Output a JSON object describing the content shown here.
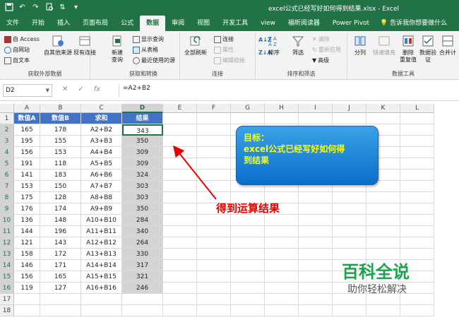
{
  "window": {
    "title": "excel公式已经写好如何得到结果.xlsx  -  Excel"
  },
  "tabs": [
    {
      "label": "文件",
      "active": false
    },
    {
      "label": "开始",
      "active": false
    },
    {
      "label": "插入",
      "active": false
    },
    {
      "label": "页面布局",
      "active": false
    },
    {
      "label": "公式",
      "active": false
    },
    {
      "label": "数据",
      "active": true
    },
    {
      "label": "审阅",
      "active": false
    },
    {
      "label": "视图",
      "active": false
    },
    {
      "label": "开发工具",
      "active": false
    },
    {
      "label": "view",
      "active": false
    },
    {
      "label": "福昕阅读器",
      "active": false
    },
    {
      "label": "Power Pivot",
      "active": false
    }
  ],
  "tell_me": "告诉我你想要做什么",
  "ribbon": {
    "get_external": {
      "label": "获取外部数据",
      "access": "自 Access",
      "web": "自网站",
      "text": "自文本",
      "other": "自其他来源",
      "existing": "现有连接"
    },
    "get_transform": {
      "label": "获取和转换",
      "new_query": "新建\n查询",
      "show_queries": "显示查询",
      "from_table": "从表格",
      "recent_sources": "最近使用的源"
    },
    "connections": {
      "label": "连接",
      "refresh_all": "全部刷新",
      "connections": "连接",
      "properties": "属性",
      "edit_links": "编辑链接"
    },
    "sort_filter": {
      "label": "排序和筛选",
      "sort": "排序",
      "filter": "筛选",
      "clear": "清除",
      "reapply": "重新应用",
      "advanced": "高级"
    },
    "data_tools": {
      "label": "数据工具",
      "split": "分列",
      "flash_fill": "快速填充",
      "remove_dup": "删除\n重复值",
      "validation": "数据验\n证",
      "consolidate": "合并计"
    }
  },
  "formula_bar": {
    "name_box": "D2",
    "formula": "=A2+B2"
  },
  "sheet": {
    "columns": [
      "A",
      "B",
      "C",
      "D",
      "E",
      "F",
      "G",
      "H",
      "I",
      "J",
      "K",
      "L"
    ],
    "header_row": [
      "数值A",
      "数值B",
      "求和",
      "结果"
    ],
    "rows": [
      [
        "165",
        "178",
        "A2+B2",
        "343"
      ],
      [
        "195",
        "155",
        "A3+B3",
        "350"
      ],
      [
        "156",
        "153",
        "A4+B4",
        "309"
      ],
      [
        "191",
        "118",
        "A5+B5",
        "309"
      ],
      [
        "141",
        "183",
        "A6+B6",
        "324"
      ],
      [
        "153",
        "150",
        "A7+B7",
        "303"
      ],
      [
        "175",
        "128",
        "A8+B8",
        "303"
      ],
      [
        "176",
        "174",
        "A9+B9",
        "350"
      ],
      [
        "136",
        "148",
        "A10+B10",
        "284"
      ],
      [
        "144",
        "196",
        "A11+B11",
        "340"
      ],
      [
        "121",
        "143",
        "A12+B12",
        "264"
      ],
      [
        "158",
        "172",
        "A13+B13",
        "330"
      ],
      [
        "146",
        "171",
        "A14+B14",
        "317"
      ],
      [
        "156",
        "165",
        "A15+B15",
        "321"
      ],
      [
        "119",
        "127",
        "A16+B16",
        "246"
      ]
    ],
    "row_numbers": [
      "1",
      "2",
      "3",
      "4",
      "5",
      "6",
      "7",
      "8",
      "9",
      "10",
      "11",
      "12",
      "13",
      "14",
      "15",
      "16",
      "17",
      "18"
    ]
  },
  "callout": {
    "line1": "目标：",
    "line2": "excel公式已经写好如何得",
    "line3": "到结果"
  },
  "annotation": "得到运算结果",
  "watermark": {
    "title": "百科全说",
    "subtitle": "助你轻松解决"
  },
  "colors": {
    "excel_green": "#217346",
    "header_blue": "#4472c4",
    "annotation_red": "#e60000",
    "callout_text": "#ffff00",
    "watermark_green": "#1aa34a"
  }
}
